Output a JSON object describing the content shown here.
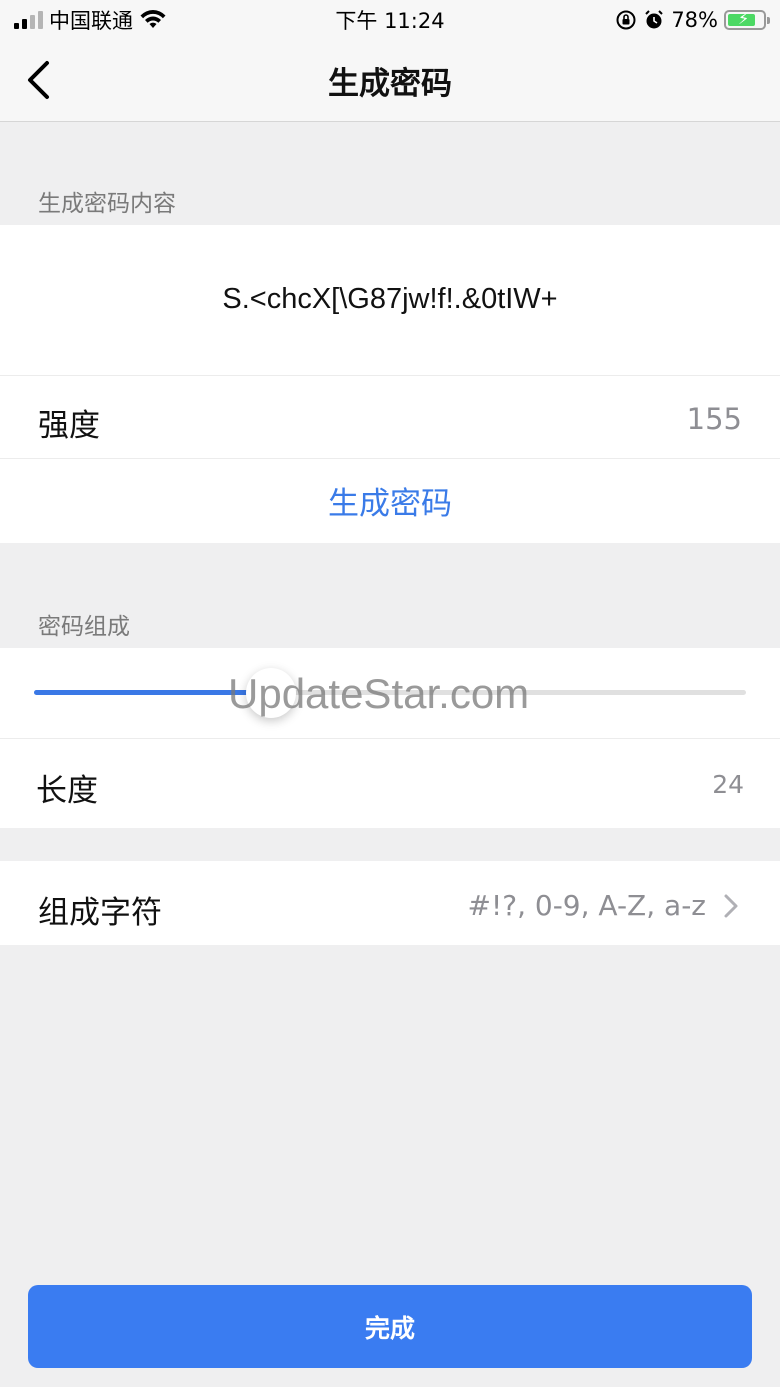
{
  "status_bar": {
    "carrier": "中国联通",
    "time": "下午 11:24",
    "battery_percent": "78%",
    "battery_level": 0.78
  },
  "nav": {
    "title": "生成密码"
  },
  "content_section": {
    "label": "生成密码内容",
    "password": "S.<chcX[\\G87jw!f!.&0tIW+",
    "strength_label": "强度",
    "strength_value": "155",
    "generate_label": "生成密码"
  },
  "composition_section": {
    "label": "密码组成",
    "slider_value": 24,
    "slider_range": [
      4,
      64
    ],
    "length_label": "长度",
    "length_value": "24",
    "chars_label": "组成字符",
    "chars_value": "#!?, 0-9, A-Z, a-z"
  },
  "watermark": "UpdateStar.com",
  "done_button": "完成",
  "colors": {
    "accent": "#3a7be8",
    "button": "#3a7cf1",
    "background": "#efeff0"
  }
}
